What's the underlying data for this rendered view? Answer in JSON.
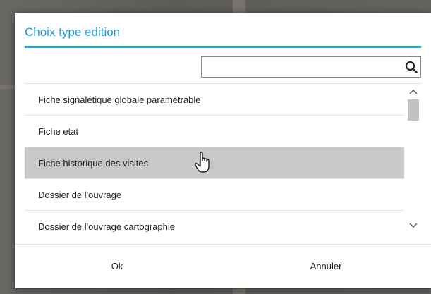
{
  "dialog": {
    "title": "Choix type edition",
    "search": {
      "value": "",
      "placeholder": ""
    },
    "items": [
      {
        "label": "Fiche signalétique globale paramétrable",
        "selected": false
      },
      {
        "label": "Fiche etat",
        "selected": false
      },
      {
        "label": "Fiche historique des visites",
        "selected": true
      },
      {
        "label": "Dossier de l'ouvrage",
        "selected": false
      },
      {
        "label": "Dossier de l'ouvrage cartographie",
        "selected": false
      }
    ],
    "buttons": {
      "ok": "Ok",
      "cancel": "Annuler"
    }
  },
  "icons": {
    "search": "search-icon",
    "scroll_up": "chevron-up-icon",
    "scroll_down": "chevron-down-icon",
    "cursor": "hand-pointer-icon"
  },
  "colors": {
    "accent": "#1a9edb",
    "selected_row": "#c8c8c8",
    "scroll_thumb": "#c2c2c2"
  }
}
